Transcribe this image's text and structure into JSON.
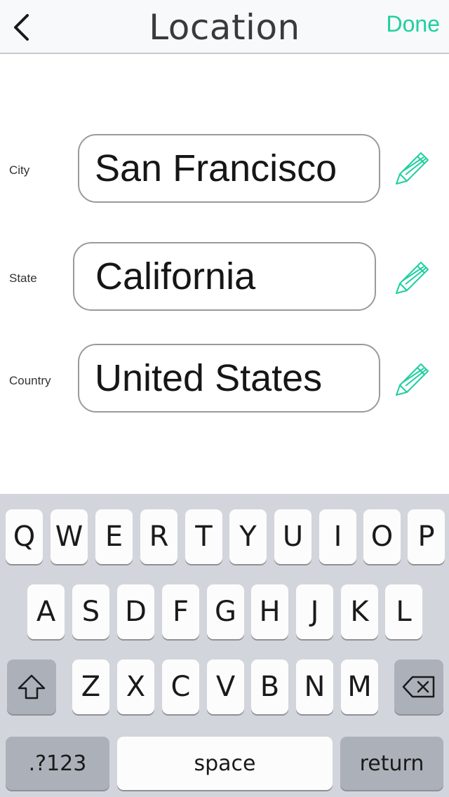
{
  "navbar": {
    "title": "Location",
    "done_label": "Done",
    "back_icon": "chevron-left-icon",
    "accent_color": "#1fcf9f"
  },
  "form": {
    "rows": [
      {
        "label": "City",
        "value": "San Francisco"
      },
      {
        "label": "State",
        "value": "California"
      },
      {
        "label": "Country",
        "value": "United States"
      }
    ],
    "edit_icon": "pencil-icon"
  },
  "keyboard": {
    "row1": [
      "Q",
      "W",
      "E",
      "R",
      "T",
      "Y",
      "U",
      "I",
      "O",
      "P"
    ],
    "row2": [
      "A",
      "S",
      "D",
      "F",
      "G",
      "H",
      "J",
      "K",
      "L"
    ],
    "row3": [
      "Z",
      "X",
      "C",
      "V",
      "B",
      "N",
      "M"
    ],
    "shift_icon": "shift-icon",
    "delete_icon": "backspace-icon",
    "numbers_label": ".?123",
    "space_label": "space",
    "return_label": "return"
  }
}
